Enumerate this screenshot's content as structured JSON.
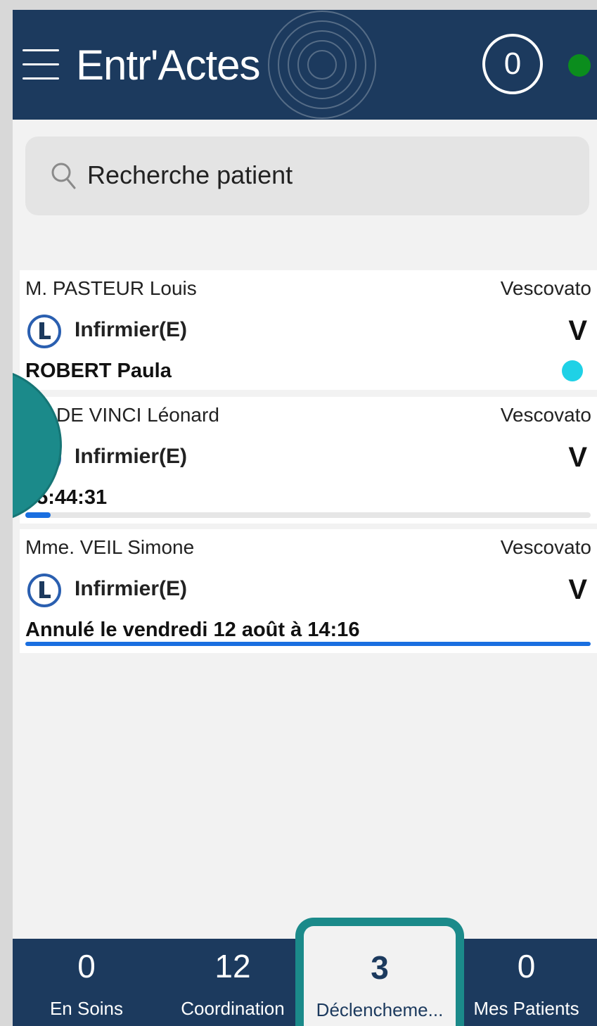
{
  "header": {
    "title": "Entr'Actes",
    "counter": "0",
    "status_color": "#0b8d1d"
  },
  "search": {
    "placeholder": "Recherche patient"
  },
  "patients": [
    {
      "name": "M. PASTEUR Louis",
      "city": "Vescovato",
      "role": "Infirmier(E)",
      "flag": "V",
      "detail": "ROBERT Paula",
      "indicator_color": "#1fd1e6"
    },
    {
      "name": "DE VINCI Léonard",
      "city": "Vescovato",
      "role": "Infirmier(E)",
      "flag": "V",
      "detail": "05:44:31",
      "progress": 0.045
    },
    {
      "name": "Mme. VEIL Simone",
      "city": "Vescovato",
      "role": "Infirmier(E)",
      "flag": "V",
      "detail": "Annulé le vendredi 12 août à 14:16"
    }
  ],
  "bottom_nav": [
    {
      "count": "0",
      "label": "En Soins"
    },
    {
      "count": "12",
      "label": "Coordination"
    },
    {
      "count": "3",
      "label": "Déclencheme..."
    },
    {
      "count": "0",
      "label": "Mes Patients"
    }
  ],
  "colors": {
    "header": "#1c3a5e",
    "accent_teal": "#1b8a8a",
    "progress_blue": "#1a6fe0"
  }
}
